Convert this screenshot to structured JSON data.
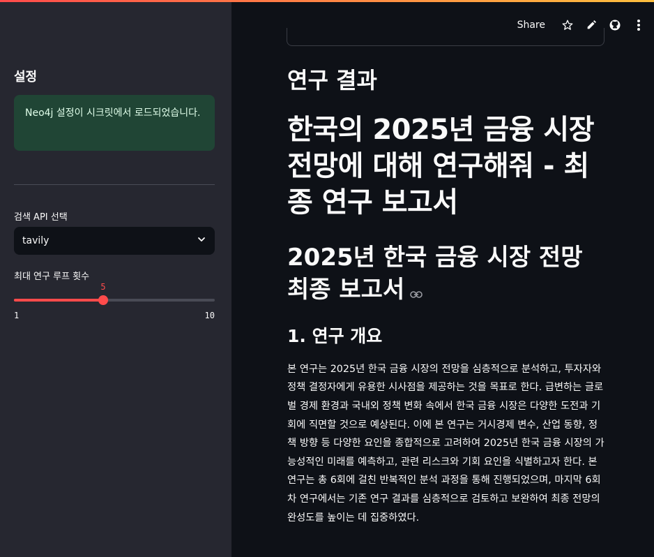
{
  "sidebar": {
    "title": "설정",
    "alert": "Neo4j 설정이 시크릿에서 로드되었습니다.",
    "search_api": {
      "label": "검색 API 선택",
      "selected": "tavily"
    },
    "loop_slider": {
      "label": "최대 연구 루프 횟수",
      "value": "5",
      "min": "1",
      "max": "10",
      "fraction": 0.444
    }
  },
  "toolbar": {
    "share_label": "Share",
    "icons": [
      "star-icon",
      "pencil-icon",
      "github-icon",
      "more-vertical-icon"
    ]
  },
  "main": {
    "section_title": "연구 결과",
    "report_title": "한국의 2025년 금융 시장 전망에 대해 연구해줘 - 최종 연구 보고서",
    "subtitle": "2025년 한국 금융 시장 전망 최종 보고서",
    "section1_title": "1. 연구 개요",
    "section1_body": "본 연구는 2025년 한국 금융 시장의 전망을 심층적으로 분석하고, 투자자와 정책 결정자에게 유용한 시사점을 제공하는 것을 목표로 한다. 급변하는 글로벌 경제 환경과 국내외 정책 변화 속에서 한국 금융 시장은 다양한 도전과 기회에 직면할 것으로 예상된다. 이에 본 연구는 거시경제 변수, 산업 동향, 정책 방향 등 다양한 요인을 종합적으로 고려하여 2025년 한국 금융 시장의 가능성적인 미래를 예측하고, 관련 리스크와 기회 요인을 식별하고자 한다. 본 연구는 총 6회에 걸친 반복적인 분석 과정을 통해 진행되었으며, 마지막 6회차 연구에서는 기존 연구 결과를 심층적으로 검토하고 보완하여 최종 전망의 완성도를 높이는 데 집중하였다."
  },
  "colors": {
    "accent": "#ff4b4b",
    "sidebar_bg": "#262730",
    "main_bg": "#0e1117",
    "success_bg": "#204535"
  }
}
